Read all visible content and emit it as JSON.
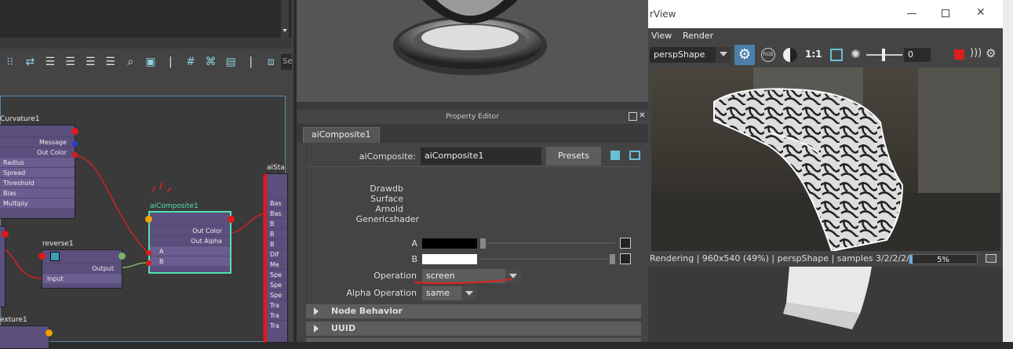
{
  "node_editor": {
    "toolbar_icons": [
      "attr-icon",
      "swap-icon",
      "list-icon",
      "list2-icon",
      "list3-icon",
      "list4-icon",
      "search-icon",
      "frame-icon",
      "separator-icon",
      "grid-icon",
      "snap-icon",
      "camera-icon",
      "separator2-icon",
      "layout-icon"
    ],
    "toolbar_search_stub": "Se",
    "nodes": {
      "curvature": {
        "title": "Curvature1",
        "rows_out": [
          "Message",
          "Out Color"
        ],
        "rows_in": [
          "Radius",
          "Spread",
          "Threshold",
          "Bias",
          "Multiply"
        ]
      },
      "reverse": {
        "title": "reverse1",
        "out": "Output",
        "in": "Input"
      },
      "composite": {
        "title": "aiComposite1",
        "rows_out": [
          "Out Color",
          "Out Alpha"
        ],
        "rows_in": [
          "A",
          "B"
        ]
      },
      "standard": {
        "title": "aiSta",
        "rows": [
          "Bas",
          "Bas",
          "B",
          "B",
          "B",
          "Dif",
          "Me",
          "Spe",
          "Spe",
          "Spe",
          "Tra",
          "Tra",
          "Tra",
          "Tra"
        ]
      },
      "texture": {
        "title": "exture1"
      }
    }
  },
  "property_editor": {
    "title": "Property Editor",
    "tab": "aiComposite1",
    "node_label": "aiComposite:",
    "node_value": "aiComposite1",
    "presets": "Presets",
    "classification": [
      "Drawdb",
      "Surface",
      "Arnold",
      "Genericshader"
    ],
    "a_label": "A",
    "b_label": "B",
    "operation_label": "Operation",
    "operation_value": "screen",
    "alpha_label": "Alpha Operation",
    "alpha_value": "same",
    "sections": [
      "Node Behavior",
      "UUID"
    ],
    "colors": {
      "a": "#000000",
      "b": "#ffffff"
    }
  },
  "render_view": {
    "title": "rView",
    "menu": [
      "View",
      "Render"
    ],
    "camera": "perspShape",
    "ratio": "1:1",
    "exposure": "0",
    "status": "Rendering | 960x540 (49%) | perspShape  | samples 3/2/2/2/2/2",
    "progress_text": "5%",
    "progress": 0.05
  }
}
